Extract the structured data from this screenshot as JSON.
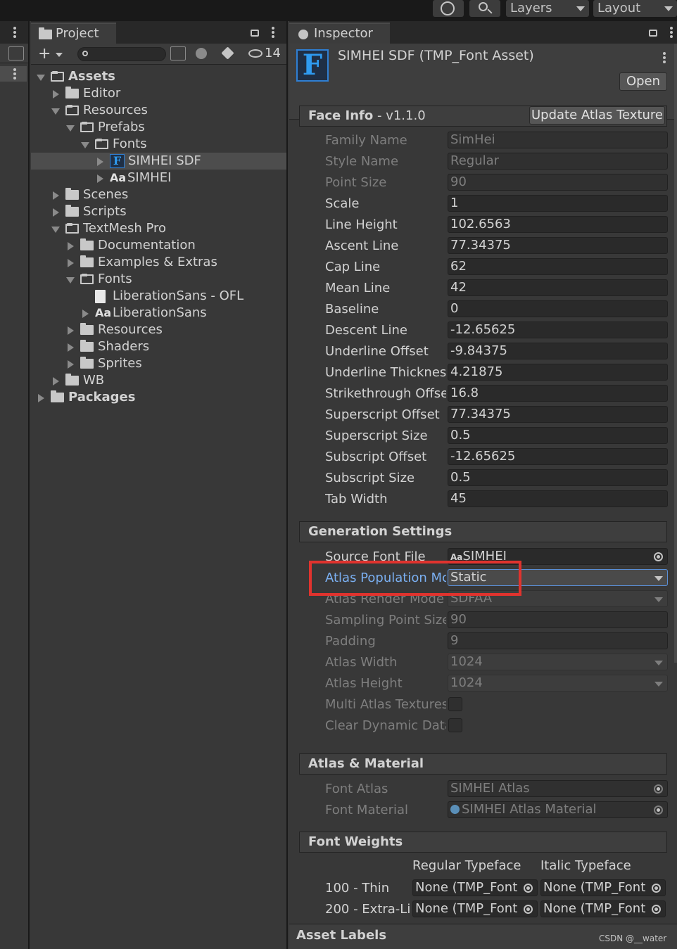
{
  "topbar": {
    "layers_label": "Layers",
    "layout_label": "Layout"
  },
  "project": {
    "tab_label": "Project",
    "hidden_count": "14",
    "tree": [
      {
        "label": "Assets",
        "depth": 0,
        "expanded": true,
        "type": "folder",
        "bold": true
      },
      {
        "label": "Editor",
        "depth": 1,
        "expanded": false,
        "type": "folder"
      },
      {
        "label": "Resources",
        "depth": 1,
        "expanded": true,
        "type": "folder"
      },
      {
        "label": "Prefabs",
        "depth": 2,
        "expanded": true,
        "type": "folder"
      },
      {
        "label": "Fonts",
        "depth": 3,
        "expanded": true,
        "type": "folder"
      },
      {
        "label": "SIMHEI SDF",
        "depth": 4,
        "expanded": false,
        "type": "fontasset",
        "selected": true
      },
      {
        "label": "SIMHEI",
        "depth": 4,
        "expanded": false,
        "type": "font"
      },
      {
        "label": "Scenes",
        "depth": 1,
        "expanded": false,
        "type": "folder"
      },
      {
        "label": "Scripts",
        "depth": 1,
        "expanded": false,
        "type": "folder"
      },
      {
        "label": "TextMesh Pro",
        "depth": 1,
        "expanded": true,
        "type": "folder"
      },
      {
        "label": "Documentation",
        "depth": 2,
        "expanded": false,
        "type": "folder"
      },
      {
        "label": "Examples & Extras",
        "depth": 2,
        "expanded": false,
        "type": "folder"
      },
      {
        "label": "Fonts",
        "depth": 2,
        "expanded": true,
        "type": "folder"
      },
      {
        "label": "LiberationSans - OFL",
        "depth": 3,
        "type": "textfile",
        "leaf": true
      },
      {
        "label": "LiberationSans",
        "depth": 3,
        "expanded": false,
        "type": "font"
      },
      {
        "label": "Resources",
        "depth": 2,
        "expanded": false,
        "type": "folder"
      },
      {
        "label": "Shaders",
        "depth": 2,
        "expanded": false,
        "type": "folder"
      },
      {
        "label": "Sprites",
        "depth": 2,
        "expanded": false,
        "type": "folder"
      },
      {
        "label": "WB",
        "depth": 1,
        "expanded": false,
        "type": "folder"
      },
      {
        "label": "Packages",
        "depth": 0,
        "expanded": false,
        "type": "folder",
        "bold": true
      }
    ]
  },
  "inspector": {
    "tab_label": "Inspector",
    "asset_title": "SIMHEI SDF (TMP_Font Asset)",
    "open_button": "Open",
    "face_info": {
      "header": "Face Info",
      "version": " - v1.1.0",
      "update_button": "Update Atlas Texture",
      "rows": [
        {
          "label": "Family Name",
          "value": "SimHei",
          "dim": true
        },
        {
          "label": "Style Name",
          "value": "Regular",
          "dim": true
        },
        {
          "label": "Point Size",
          "value": "90",
          "dim": true
        },
        {
          "label": "Scale",
          "value": "1"
        },
        {
          "label": "Line Height",
          "value": "102.6563"
        },
        {
          "label": "Ascent Line",
          "value": "77.34375"
        },
        {
          "label": "Cap Line",
          "value": "62"
        },
        {
          "label": "Mean Line",
          "value": "42"
        },
        {
          "label": "Baseline",
          "value": "0"
        },
        {
          "label": "Descent Line",
          "value": "-12.65625"
        },
        {
          "label": "Underline Offset",
          "value": "-9.84375"
        },
        {
          "label": "Underline Thicknes",
          "value": "4.21875"
        },
        {
          "label": "Strikethrough Offse",
          "value": "16.8"
        },
        {
          "label": "Superscript Offset",
          "value": "77.34375"
        },
        {
          "label": "Superscript Size",
          "value": "0.5"
        },
        {
          "label": "Subscript Offset",
          "value": "-12.65625"
        },
        {
          "label": "Subscript Size",
          "value": "0.5"
        },
        {
          "label": "Tab Width",
          "value": "45"
        }
      ]
    },
    "generation": {
      "header": "Generation Settings",
      "source_font_label": "Source Font File",
      "source_font_prefix": "Aa",
      "source_font_value": "SIMHEI",
      "atlas_pop_label": "Atlas Population Mc",
      "atlas_pop_value": "Static",
      "render_mode_label": "Atlas Render Mode",
      "render_mode_value": "SDFAA",
      "sampling_label": "Sampling Point Size",
      "sampling_value": "90",
      "padding_label": "Padding",
      "padding_value": "9",
      "atlas_width_label": "Atlas Width",
      "atlas_width_value": "1024",
      "atlas_height_label": "Atlas Height",
      "atlas_height_value": "1024",
      "multi_atlas_label": "Multi Atlas Textures",
      "clear_dynamic_label": "Clear Dynamic Data"
    },
    "atlas_material": {
      "header": "Atlas & Material",
      "font_atlas_label": "Font Atlas",
      "font_atlas_value": "SIMHEI Atlas",
      "font_material_label": "Font Material",
      "font_material_value": "SIMHEI Atlas Material"
    },
    "font_weights": {
      "header": "Font Weights",
      "regular_col": "Regular Typeface",
      "italic_col": "Italic Typeface",
      "rows": [
        {
          "label": "100 - Thin",
          "regular": "None (TMP_Font",
          "italic": "None (TMP_Font"
        },
        {
          "label": "200 - Extra-Li",
          "regular": "None (TMP_Font",
          "italic": "None (TMP_Font"
        }
      ]
    },
    "asset_labels": "Asset Labels"
  },
  "watermark": "CSDN @__water",
  "colors": {
    "highlight_box": "#e0332e",
    "accent_blue": "#7bb0f2",
    "font_asset_icon": "#2f7fd3"
  }
}
